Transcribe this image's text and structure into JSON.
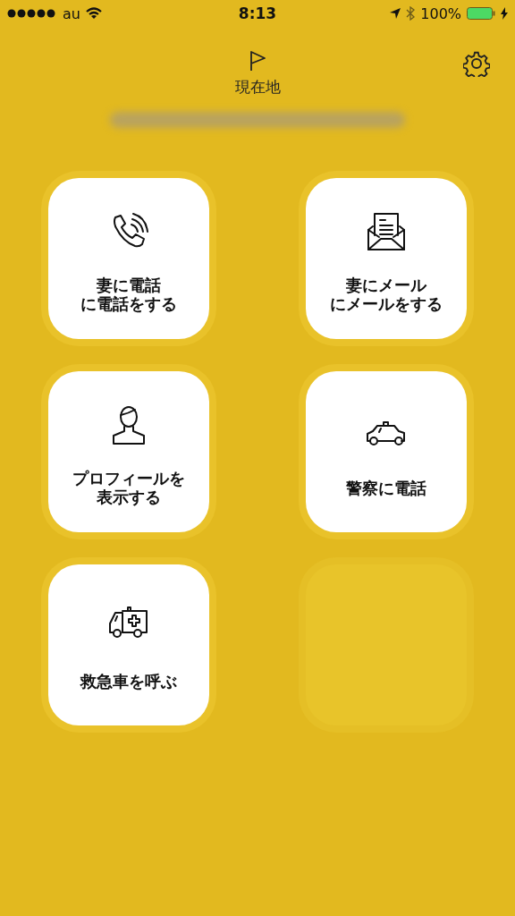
{
  "status_bar": {
    "carrier": "au",
    "time": "8:13",
    "battery": "100%"
  },
  "header": {
    "title": "現在地"
  },
  "tiles": [
    {
      "kind": "action",
      "label": [
        "妻に電話",
        "に電話をする"
      ]
    },
    {
      "kind": "action",
      "label": [
        "妻にメール",
        "にメールをする"
      ]
    },
    {
      "kind": "action",
      "label": [
        "プロフィールを",
        "表示する"
      ]
    },
    {
      "kind": "action",
      "label": [
        "警察に電話"
      ]
    },
    {
      "kind": "action",
      "label": [
        "救急車を呼ぶ"
      ]
    },
    {
      "kind": "empty"
    }
  ]
}
